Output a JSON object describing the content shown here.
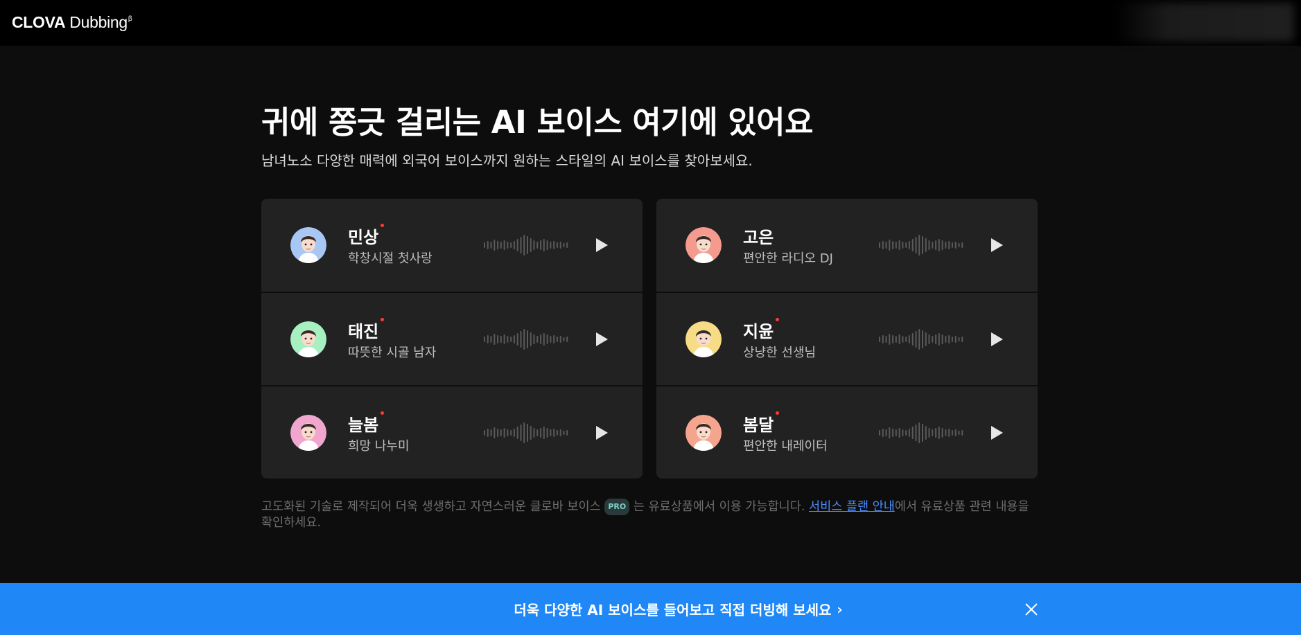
{
  "header": {
    "logo_brand": "CLOVA",
    "logo_product": "Dubbing",
    "logo_sup": "β"
  },
  "hero": {
    "title": "귀에 쫑긋 걸리는 AI 보이스 여기에 있어요",
    "subtitle": "남녀노소 다양한 매력에 외국어 보이스까지 원하는 스타일의 AI 보이스를 찾아보세요."
  },
  "voices_left": [
    {
      "name": "민상",
      "desc": "학창시절 첫사랑",
      "new": true,
      "avatar_color": "#a9c7f5"
    },
    {
      "name": "태진",
      "desc": "따뜻한 시골 남자",
      "new": true,
      "avatar_color": "#a6f0c2"
    },
    {
      "name": "늘봄",
      "desc": "희망 나누미",
      "new": true,
      "avatar_color": "#f0a6cf"
    }
  ],
  "voices_right": [
    {
      "name": "고은",
      "desc": "편안한 라디오 DJ",
      "new": false,
      "avatar_color": "#f59a8e"
    },
    {
      "name": "지윤",
      "desc": "상냥한 선생님",
      "new": true,
      "avatar_color": "#f7dc86"
    },
    {
      "name": "봄달",
      "desc": "편안한 내레이터",
      "new": true,
      "avatar_color": "#f5a58e"
    }
  ],
  "footnote": {
    "before_badge": "고도화된 기술로 제작되어 더욱 생생하고 자연스러운 클로바 보이스",
    "badge": "PRO",
    "after_badge": " 는 유료상품에서 이용 가능합니다. ",
    "link": "서비스 플랜 안내",
    "after_link": "에서 유료상품 관련 내용을 확인하세요."
  },
  "banner": {
    "text": "더욱 다양한 AI 보이스를 들어보고 직접 더빙해 보세요",
    "chevron": "›"
  },
  "colors": {
    "accent": "#1f87f6",
    "new_dot": "#ff3b30",
    "link": "#4a8cff"
  }
}
